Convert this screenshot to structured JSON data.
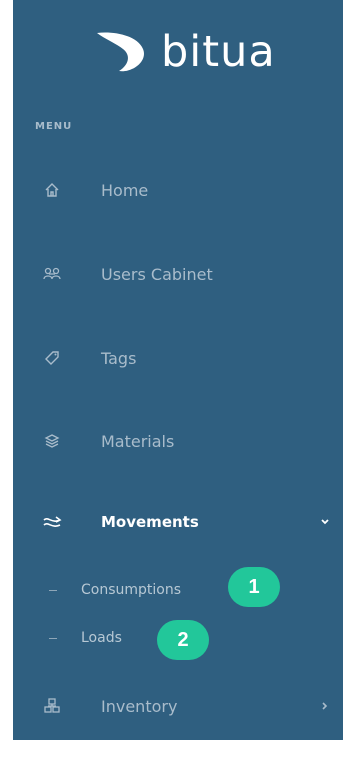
{
  "brand": {
    "name": "bitua"
  },
  "menu": {
    "section_label": "MENU"
  },
  "nav": [
    {
      "label": "Home",
      "icon": "home-icon"
    },
    {
      "label": "Users Cabinet",
      "icon": "users-icon"
    },
    {
      "label": "Tags",
      "icon": "tag-icon"
    },
    {
      "label": "Materials",
      "icon": "materials-icon"
    },
    {
      "label": "Movements",
      "icon": "movements-icon",
      "active": true,
      "expanded": true,
      "children": [
        {
          "label": "Consumptions"
        },
        {
          "label": "Loads"
        }
      ]
    },
    {
      "label": "Inventory",
      "icon": "inventory-icon",
      "expanded": false
    }
  ],
  "badges": [
    "1",
    "2"
  ],
  "colors": {
    "sidebar": "#2f5f80",
    "badge": "#22c79a",
    "text_muted": "#a9bccb",
    "text_active": "#ffffff"
  }
}
